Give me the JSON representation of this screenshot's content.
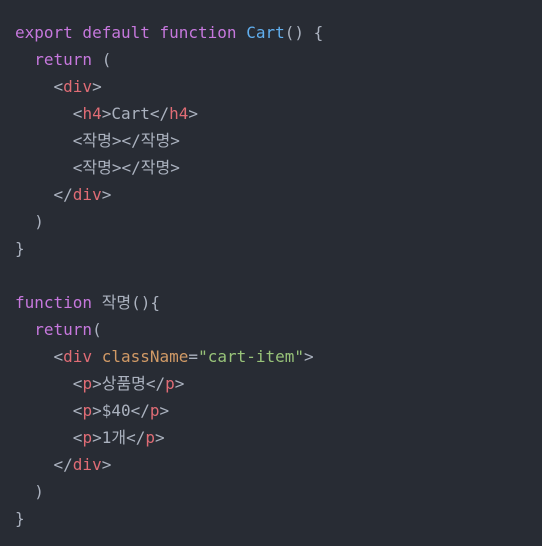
{
  "colors": {
    "background": "#282c34",
    "keyword": "#c678dd",
    "function": "#61afef",
    "plain": "#abb2bf",
    "tag": "#e06c75",
    "attr": "#d19a66",
    "string": "#98c379"
  },
  "lines": [
    [
      {
        "t": "export default function ",
        "c": "keyword"
      },
      {
        "t": "Cart",
        "c": "function"
      },
      {
        "t": "() {",
        "c": "plain"
      }
    ],
    [
      {
        "t": "  ",
        "c": "plain"
      },
      {
        "t": "return",
        "c": "keyword"
      },
      {
        "t": " (",
        "c": "plain"
      }
    ],
    [
      {
        "t": "    <",
        "c": "plain"
      },
      {
        "t": "div",
        "c": "tag"
      },
      {
        "t": ">",
        "c": "plain"
      }
    ],
    [
      {
        "t": "      <",
        "c": "plain"
      },
      {
        "t": "h4",
        "c": "tag"
      },
      {
        "t": ">Cart</",
        "c": "plain"
      },
      {
        "t": "h4",
        "c": "tag"
      },
      {
        "t": ">",
        "c": "plain"
      }
    ],
    [
      {
        "t": "      <작명></작명>",
        "c": "plain"
      }
    ],
    [
      {
        "t": "      <작명></작명>",
        "c": "plain"
      }
    ],
    [
      {
        "t": "    </",
        "c": "plain"
      },
      {
        "t": "div",
        "c": "tag"
      },
      {
        "t": ">",
        "c": "plain"
      }
    ],
    [
      {
        "t": "  )",
        "c": "plain"
      }
    ],
    [
      {
        "t": "}",
        "c": "plain"
      }
    ],
    [],
    [
      {
        "t": "function",
        "c": "keyword"
      },
      {
        "t": " 작명(){",
        "c": "plain"
      }
    ],
    [
      {
        "t": "  ",
        "c": "plain"
      },
      {
        "t": "return",
        "c": "keyword"
      },
      {
        "t": "(",
        "c": "plain"
      }
    ],
    [
      {
        "t": "    <",
        "c": "plain"
      },
      {
        "t": "div",
        "c": "tag"
      },
      {
        "t": " ",
        "c": "plain"
      },
      {
        "t": "className",
        "c": "attr"
      },
      {
        "t": "=",
        "c": "plain"
      },
      {
        "t": "\"cart-item\"",
        "c": "string"
      },
      {
        "t": ">",
        "c": "plain"
      }
    ],
    [
      {
        "t": "      <",
        "c": "plain"
      },
      {
        "t": "p",
        "c": "tag"
      },
      {
        "t": ">상품명</",
        "c": "plain"
      },
      {
        "t": "p",
        "c": "tag"
      },
      {
        "t": ">",
        "c": "plain"
      }
    ],
    [
      {
        "t": "      <",
        "c": "plain"
      },
      {
        "t": "p",
        "c": "tag"
      },
      {
        "t": ">$40</",
        "c": "plain"
      },
      {
        "t": "p",
        "c": "tag"
      },
      {
        "t": ">",
        "c": "plain"
      }
    ],
    [
      {
        "t": "      <",
        "c": "plain"
      },
      {
        "t": "p",
        "c": "tag"
      },
      {
        "t": ">1개</",
        "c": "plain"
      },
      {
        "t": "p",
        "c": "tag"
      },
      {
        "t": ">",
        "c": "plain"
      }
    ],
    [
      {
        "t": "    </",
        "c": "plain"
      },
      {
        "t": "div",
        "c": "tag"
      },
      {
        "t": ">",
        "c": "plain"
      }
    ],
    [
      {
        "t": "  )",
        "c": "plain"
      }
    ],
    [
      {
        "t": "}",
        "c": "plain"
      }
    ]
  ]
}
